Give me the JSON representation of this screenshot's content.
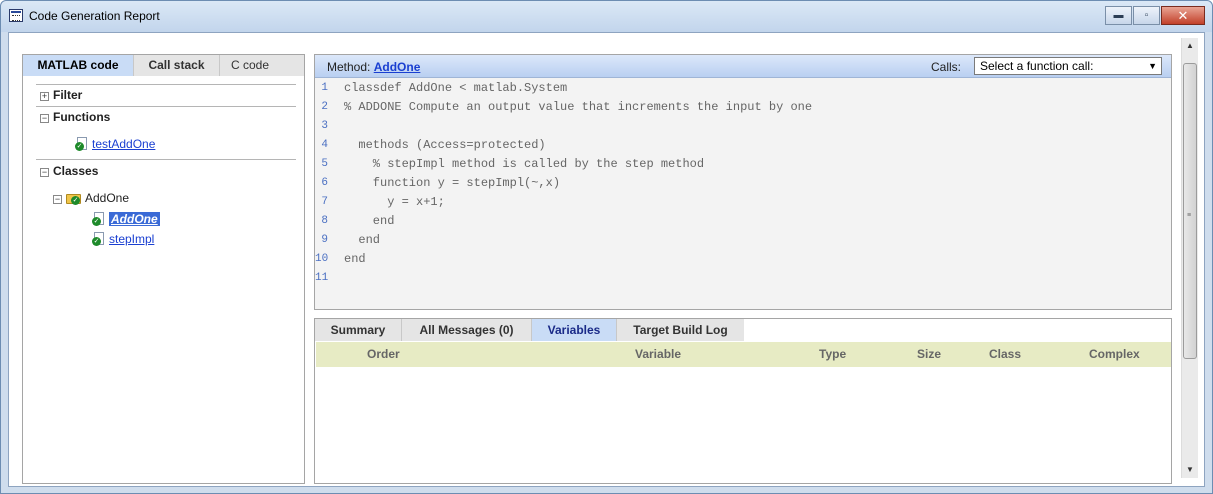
{
  "window": {
    "title": "Code Generation Report",
    "controls": {
      "minimize": "▬",
      "maximize": "▫",
      "close": "✕"
    }
  },
  "left_panel": {
    "tabs": [
      {
        "label": "MATLAB code",
        "active": true
      },
      {
        "label": "Call stack",
        "active": false
      },
      {
        "label": "C code",
        "active": false
      }
    ],
    "sections": {
      "filter": {
        "label": "Filter",
        "toggle": "+"
      },
      "functions": {
        "label": "Functions",
        "toggle": "−"
      },
      "classes": {
        "label": "Classes",
        "toggle": "−"
      }
    },
    "functions": [
      {
        "label": "testAddOne"
      }
    ],
    "classes": [
      {
        "label": "AddOne",
        "toggle": "−",
        "methods": [
          {
            "label": "AddOne",
            "selected": true
          },
          {
            "label": "stepImpl",
            "selected": false
          }
        ]
      }
    ]
  },
  "code_panel": {
    "method_prefix": "Method:",
    "method_name": "AddOne",
    "calls_label": "Calls:",
    "calls_select_value": "Select a function call:",
    "lines": [
      {
        "n": "1",
        "text": "classdef AddOne < matlab.System"
      },
      {
        "n": "2",
        "text": "% ADDONE Compute an output value that increments the input by one"
      },
      {
        "n": "3",
        "text": ""
      },
      {
        "n": "4",
        "text": "  methods (Access=protected)"
      },
      {
        "n": "5",
        "text": "    % stepImpl method is called by the step method"
      },
      {
        "n": "6",
        "text": "    function y = stepImpl(~,x)"
      },
      {
        "n": "7",
        "text": "      y = x+1;"
      },
      {
        "n": "8",
        "text": "    end"
      },
      {
        "n": "9",
        "text": "  end"
      },
      {
        "n": "10",
        "text": "end"
      },
      {
        "n": "11",
        "text": ""
      }
    ]
  },
  "bottom_panel": {
    "tabs": [
      {
        "label": "Summary",
        "active": false
      },
      {
        "label": "All Messages (0)",
        "active": false
      },
      {
        "label": "Variables",
        "active": true
      },
      {
        "label": "Target Build Log",
        "active": false
      }
    ],
    "columns": [
      "Order",
      "Variable",
      "Type",
      "Size",
      "Class",
      "Complex"
    ]
  },
  "colors": {
    "accent_tab": "#c9dcf6",
    "link": "#1a3fd1",
    "table_header": "#e7ebc4",
    "selection": "#3a6ad6"
  }
}
